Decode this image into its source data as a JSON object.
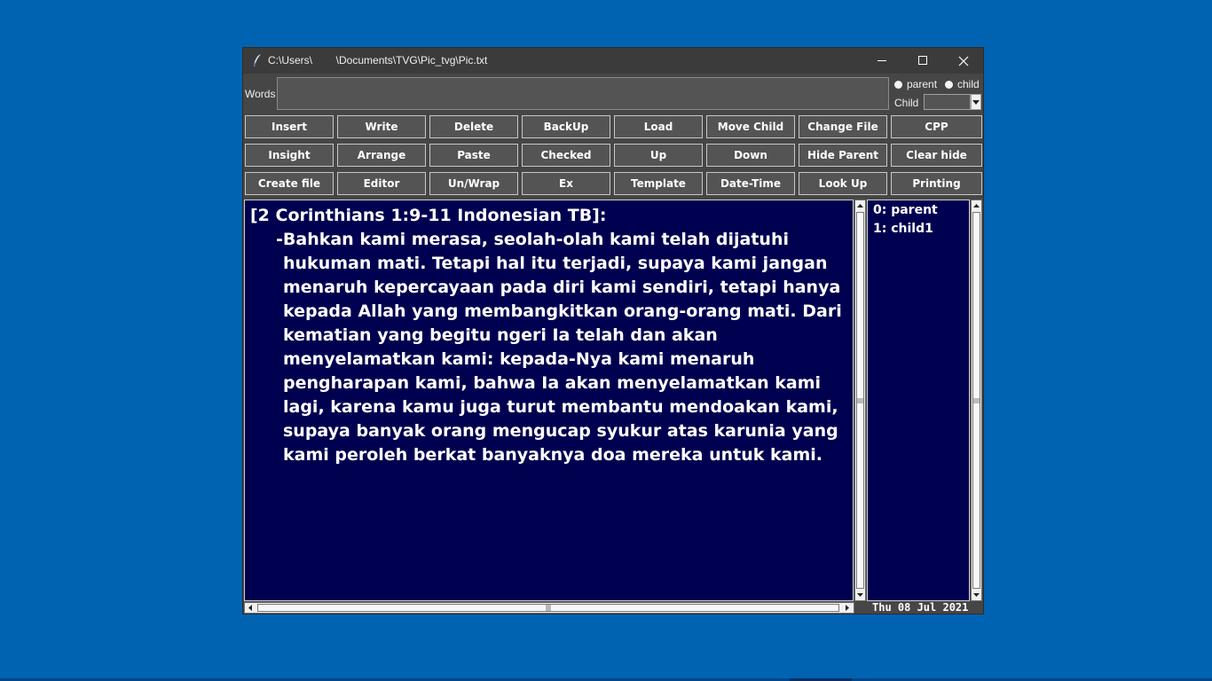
{
  "window": {
    "title": "C:\\Users\\        \\Documents\\TVG\\Pic_tvg\\Pic.txt"
  },
  "top": {
    "words_label": "Words",
    "words_value": "",
    "radio_parent": "parent",
    "radio_child": "child",
    "child_label": "Child",
    "child_value": ""
  },
  "buttons": {
    "row1": [
      "Insert",
      "Write",
      "Delete",
      "BackUp",
      "Load",
      "Move Child",
      "Change File",
      "CPP"
    ],
    "row2": [
      "Insight",
      "Arrange",
      "Paste",
      "Checked",
      "Up",
      "Down",
      "Hide Parent",
      "Clear hide"
    ],
    "row3": [
      "Create file",
      "Editor",
      "Un/Wrap",
      "Ex",
      "Template",
      "Date-Time",
      "Look Up",
      "Printing"
    ]
  },
  "editor": {
    "line1": "[2 Corinthians 1:9-11 Indonesian TB]:",
    "line2": "-Bahkan kami merasa, seolah-olah kami telah dijatuhi hukuman mati. Tetapi hal itu terjadi, supaya kami jangan menaruh kepercayaan pada diri kami sendiri, tetapi hanya kepada Allah yang membangkitkan orang-orang mati. Dari kematian yang begitu ngeri Ia telah dan akan menyelamatkan kami: kepada-Nya kami menaruh pengharapan kami, bahwa Ia akan menyelamatkan kami lagi, karena kamu juga turut membantu mendoakan kami, supaya banyak orang mengucap syukur atas karunia yang kami peroleh berkat banyaknya doa mereka untuk kami."
  },
  "list": {
    "items": [
      "0: parent",
      "1: child1"
    ]
  },
  "status": {
    "date": "Thu 08 Jul 2021"
  },
  "colors": {
    "desktop": "#0063b1",
    "window_bg": "#464646",
    "editor_bg": "#000050",
    "text": "#ffffff"
  }
}
